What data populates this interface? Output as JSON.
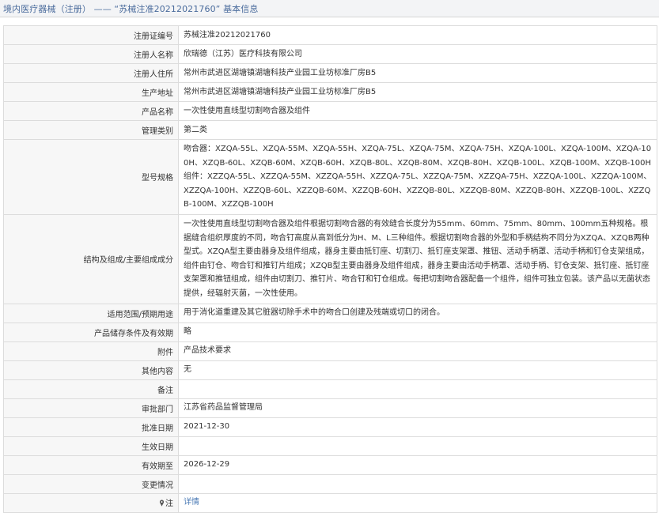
{
  "header": {
    "title": "境内医疗器械（注册） —— “苏械注准20212021760” 基本信息"
  },
  "colors": {
    "title_text": "#4a6b9c",
    "link": "#4a7ab5",
    "label_bg": "#f7f7f7",
    "border": "#dcdcdc"
  },
  "rows": [
    {
      "label": "注册证编号",
      "value": "苏械注准20212021760"
    },
    {
      "label": "注册人名称",
      "value": "欣瑞德（江苏）医疗科技有限公司"
    },
    {
      "label": "注册人住所",
      "value": "常州市武进区湖塘镇湖塘科技产业园工业坊标准厂房B5"
    },
    {
      "label": "生产地址",
      "value": "常州市武进区湖塘镇湖塘科技产业园工业坊标准厂房B5"
    },
    {
      "label": "产品名称",
      "value": "一次性使用直线型切割吻合器及组件"
    },
    {
      "label": "管理类别",
      "value": "第二类"
    },
    {
      "label": "型号规格",
      "value": "吻合器：XZQA-55L、XZQA-55M、XZQA-55H、XZQA-75L、XZQA-75M、XZQA-75H、XZQA-100L、XZQA-100M、XZQA-100H、XZQB-60L、XZQB-60M、XZQB-60H、XZQB-80L、XZQB-80M、XZQB-80H、XZQB-100L、XZQB-100M、XZQB-100H组件：XZZQA-55L、XZZQA-55M、XZZQA-55H、XZZQA-75L、XZZQA-75M、XZZQA-75H、XZZQA-100L、XZZQA-100M、XZZQA-100H、XZZQB-60L、XZZQB-60M、XZZQB-60H、XZZQB-80L、XZZQB-80M、XZZQB-80H、XZZQB-100L、XZZQB-100M、XZZQB-100H"
    },
    {
      "label": "结构及组成/主要组成成分",
      "value": "一次性使用直线型切割吻合器及组件根据切割吻合器的有效缝合长度分为55mm、60mm、75mm、80mm、100mm五种规格。根据缝合组织厚度的不同，吻合钉高度从高到低分为H、M、L三种组件。根据切割吻合器的外型和手柄结构不同分为XZQA、XZQB两种型式。XZQA型主要由器身及组件组成，器身主要由抵钉座、切割刀、抵钉座支架罩、推钮、活动手柄罩、活动手柄和钉仓支架组成，组件由钉仓、吻合钉和推钉片组成；XZQB型主要由器身及组件组成，器身主要由活动手柄罩、活动手柄、钉仓支架、抵钉座、抵钉座支架罩和推钮组成，组件由切割刀、推钉片、吻合钉和钉仓组成。每把切割吻合器配备一个组件，组件可独立包装。该产品以无菌状态提供，经辐射灭菌，一次性使用。"
    },
    {
      "label": "适用范围/预期用途",
      "value": "用于消化道重建及其它脏器切除手术中的吻合口创建及残端或切口的闭合。"
    },
    {
      "label": "产品储存条件及有效期",
      "value": "略"
    },
    {
      "label": "附件",
      "value": "产品技术要求"
    },
    {
      "label": "其他内容",
      "value": "无"
    },
    {
      "label": "备注",
      "value": ""
    },
    {
      "label": "审批部门",
      "value": "江苏省药品监督管理局"
    },
    {
      "label": "批准日期",
      "value": "2021-12-30"
    },
    {
      "label": "生效日期",
      "value": ""
    },
    {
      "label": "有效期至",
      "value": "2026-12-29"
    },
    {
      "label": "变更情况",
      "value": ""
    }
  ],
  "note": {
    "icon": "pin-icon",
    "label": "注",
    "link_text": "详情"
  }
}
